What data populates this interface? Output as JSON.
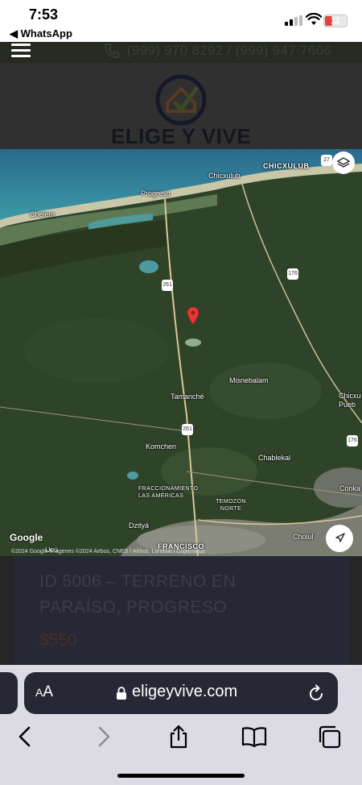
{
  "status_bar": {
    "time": "7:53",
    "back_label": "◀ WhatsApp",
    "battery": "11",
    "battery_color": "#e0443a"
  },
  "site_header": {
    "phone": "(999) 970 8292 / (999) 947 7606",
    "logo_text": "ELIGE Y VIVE",
    "icons": [
      "menu-icon",
      "phone-icon",
      "logo-mark"
    ]
  },
  "map": {
    "attribution": "Google",
    "copyright": "©2024 Google Imágenes ©2024 Airbus, CNES / Airbus, Landsat / Copernicus",
    "labels": [
      "Chicxulub",
      "CHICXULUB",
      "Progreso",
      "Chelem",
      "Misnebalam",
      "Tamanché",
      "Komchen",
      "Chablekal",
      "FRACCIONAMIENTO LAS AMÉRICAS",
      "TEMOZON NORTE",
      "Dzityá",
      "FRANCISCO",
      "Chicxu Pueb",
      "Conka",
      "Cholul",
      "Ucú"
    ],
    "road_shields": [
      "27",
      "261",
      "176",
      "261",
      "176"
    ],
    "pin_color": "#e53935"
  },
  "listing": {
    "title": "ID 5006 – TERRENO EN PARAÍSO, PROGRESO",
    "price": "$550"
  },
  "browser": {
    "aa_label": "AA",
    "url": "eligeyvive.com",
    "toolbar": [
      "back-icon",
      "forward-icon",
      "share-icon",
      "bookmarks-icon",
      "tabs-icon"
    ]
  }
}
